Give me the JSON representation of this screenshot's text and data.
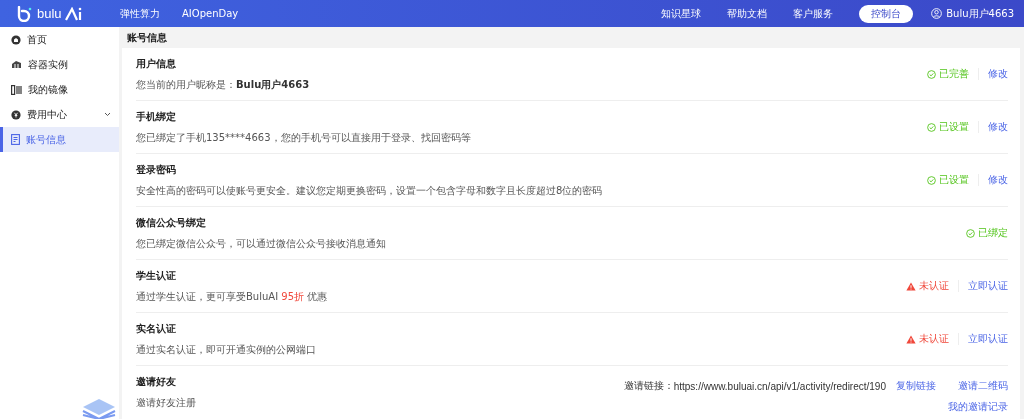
{
  "header": {
    "brand": "bulu",
    "nav": [
      "弹性算力",
      "AIOpenDay"
    ],
    "links": [
      "知识星球",
      "帮助文档",
      "客户服务"
    ],
    "console_button": "控制台",
    "user": "Bulu用户4663"
  },
  "sidebar": {
    "items": [
      {
        "label": "首页",
        "kind": "home",
        "selected": false,
        "expandable": false
      },
      {
        "label": "容器实例",
        "kind": "instances",
        "selected": false,
        "expandable": false
      },
      {
        "label": "我的镜像",
        "kind": "images",
        "selected": false,
        "expandable": false
      },
      {
        "label": "费用中心",
        "kind": "billing",
        "selected": false,
        "expandable": true
      },
      {
        "label": "账号信息",
        "kind": "account",
        "selected": true,
        "expandable": false
      }
    ]
  },
  "page_title": "账号信息",
  "sections": [
    {
      "kind": "plain",
      "title": "用户信息",
      "desc": "您当前的用户昵称是：**Bulu用户4663**",
      "status": {
        "kind": "ok",
        "text": "已完善"
      },
      "action": "修改"
    },
    {
      "kind": "plain",
      "title": "手机绑定",
      "desc": "您已绑定了手机135****4663，您的手机号可以直接用于登录、找回密码等",
      "status": {
        "kind": "ok",
        "text": "已设置"
      },
      "action": "修改"
    },
    {
      "kind": "plain",
      "title": "登录密码",
      "desc": "安全性高的密码可以使账号更安全。建议您定期更换密码，设置一个包含字母和数字且长度超过8位的密码",
      "status": {
        "kind": "ok",
        "text": "已设置"
      },
      "action": "修改"
    },
    {
      "kind": "plain",
      "title": "微信公众号绑定",
      "desc": "您已绑定微信公众号，可以通过微信公众号接收消息通知",
      "status": {
        "kind": "ok",
        "text": "已绑定"
      }
    },
    {
      "kind": "promo",
      "title": "学生认证",
      "desc": "通过学生认证，更可享受BuluAI",
      "highlight": "95折",
      "desc_tail": "优惠",
      "status": {
        "kind": "warn",
        "text": "未认证"
      },
      "action": "立即认证"
    },
    {
      "kind": "plain",
      "title": "实名认证",
      "desc": "通过实名认证，即可开通实例的公网端口",
      "status": {
        "kind": "warn",
        "text": "未认证"
      },
      "action": "立即认证"
    },
    {
      "kind": "invite",
      "title": "邀请好友",
      "desc": "邀请好友注册",
      "link_label": "邀请链接：",
      "link": "https://www.buluai.cn/api/v1/activity/redirect/190",
      "copy": "复制链接",
      "qr": "邀请二维码",
      "records": "我的邀请记录"
    }
  ]
}
